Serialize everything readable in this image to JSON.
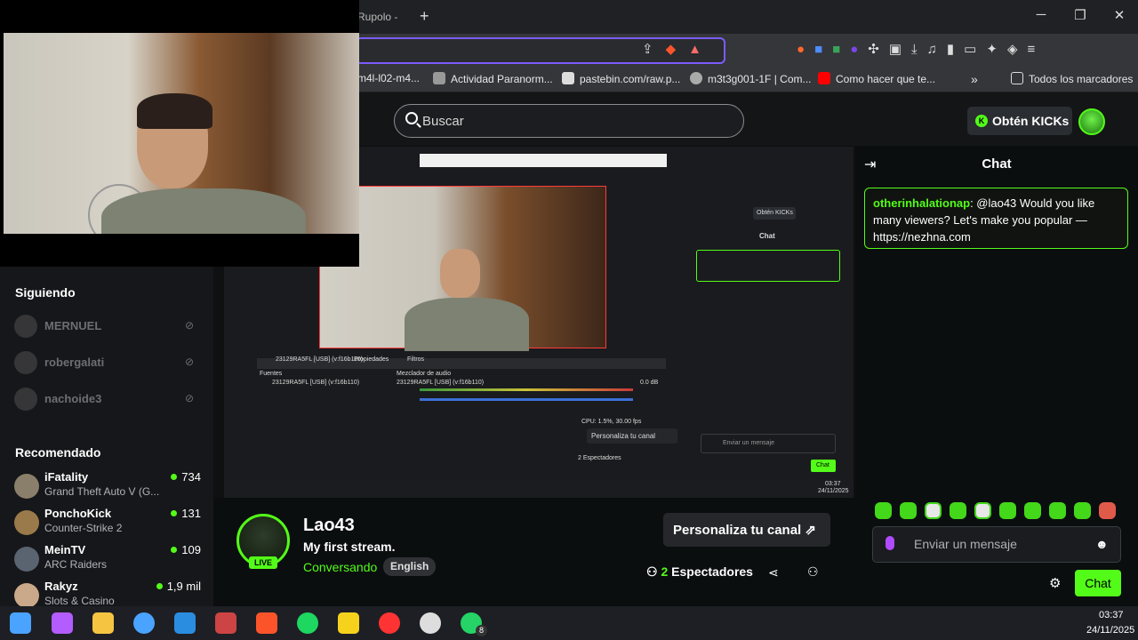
{
  "browser": {
    "tab_title": "Rupolo - ",
    "bookmarks": [
      {
        "label": "m4l-l02-m4...",
        "color": "#888888"
      },
      {
        "label": "Actividad Paranorm...",
        "color": "#bbbbbb"
      },
      {
        "label": "pastebin.com/raw.p...",
        "color": "#dddddd"
      },
      {
        "label": "m3t3g001-1F | Com...",
        "color": "#aaaaaa"
      },
      {
        "label": "Como hacer que te...",
        "color": "#ff0000"
      }
    ],
    "all_bookmarks": "Todos los marcadores",
    "overflow": "»"
  },
  "header": {
    "search_placeholder": "Buscar",
    "get_kicks": "Obtén KICKs",
    "kick_logo": "K"
  },
  "sidebar": {
    "following_title": "Siguiendo",
    "following": [
      {
        "name": "MERNUEL"
      },
      {
        "name": "robergalati"
      },
      {
        "name": "nachoide3"
      }
    ],
    "recommended_title": "Recomendado",
    "recommended": [
      {
        "name": "iFatality",
        "category": "Grand Theft Auto V (G...",
        "viewers": "734"
      },
      {
        "name": "PonchoKick",
        "category": "Counter-Strike 2",
        "viewers": "131"
      },
      {
        "name": "MeinTV",
        "category": "ARC Raiders",
        "viewers": "109"
      },
      {
        "name": "Rakyz",
        "category": "Slots & Casino",
        "viewers": "1,9 mil"
      }
    ]
  },
  "obs": {
    "sources_label": "Fuentes",
    "source_name": "23129RA5FL [USB] (v:f16b110)",
    "properties": "Propiedades",
    "filters": "Filtros",
    "mixer_label": "Mezclador de audio",
    "mixer_level": "0.0 dB",
    "cpu": "CPU: 1.5%, 30.00 fps",
    "mini_chat_title": "Chat",
    "mini_kicks": "Obtén KICKs",
    "mini_customize": "Personaliza tu canal",
    "mini_viewers": "2 Espectadores",
    "mini_input": "Enviar un mensaje",
    "mini_send": "Chat",
    "mini_time": "03:37",
    "mini_date": "24/11/2025"
  },
  "stream": {
    "streamer": "Lao43",
    "title": "My first stream.",
    "category": "Conversando",
    "language": "English",
    "live": "LIVE",
    "customize": "Personaliza tu canal",
    "viewers_count": "2",
    "viewers_label": "Espectadores"
  },
  "chat": {
    "title": "Chat",
    "message_user": "otherinhalationap",
    "message_text": ": @lao43 Would you like many viewers? Let's make you popular — https://nezhna.com",
    "placeholder": "Enviar un mensaje",
    "send": "Chat"
  },
  "taskbar": {
    "time": "03:37",
    "date": "24/11/2025",
    "whatsapp_badge": "8",
    "apps": [
      {
        "name": "windows-start",
        "color": "#4aa3ff"
      },
      {
        "name": "copilot",
        "color": "#b35cff"
      },
      {
        "name": "file-explorer",
        "color": "#f5c542"
      },
      {
        "name": "power",
        "color": "#4aa3ff"
      },
      {
        "name": "vscode",
        "color": "#2b8de0"
      },
      {
        "name": "game-app",
        "color": "#c44"
      },
      {
        "name": "brave",
        "color": "#fb542b"
      },
      {
        "name": "spotify",
        "color": "#1ed760"
      },
      {
        "name": "sticky-notes",
        "color": "#f7d21d"
      },
      {
        "name": "gauge-app",
        "color": "#ff3333"
      },
      {
        "name": "obs",
        "color": "#dddddd"
      },
      {
        "name": "whatsapp",
        "color": "#25d366"
      }
    ]
  }
}
